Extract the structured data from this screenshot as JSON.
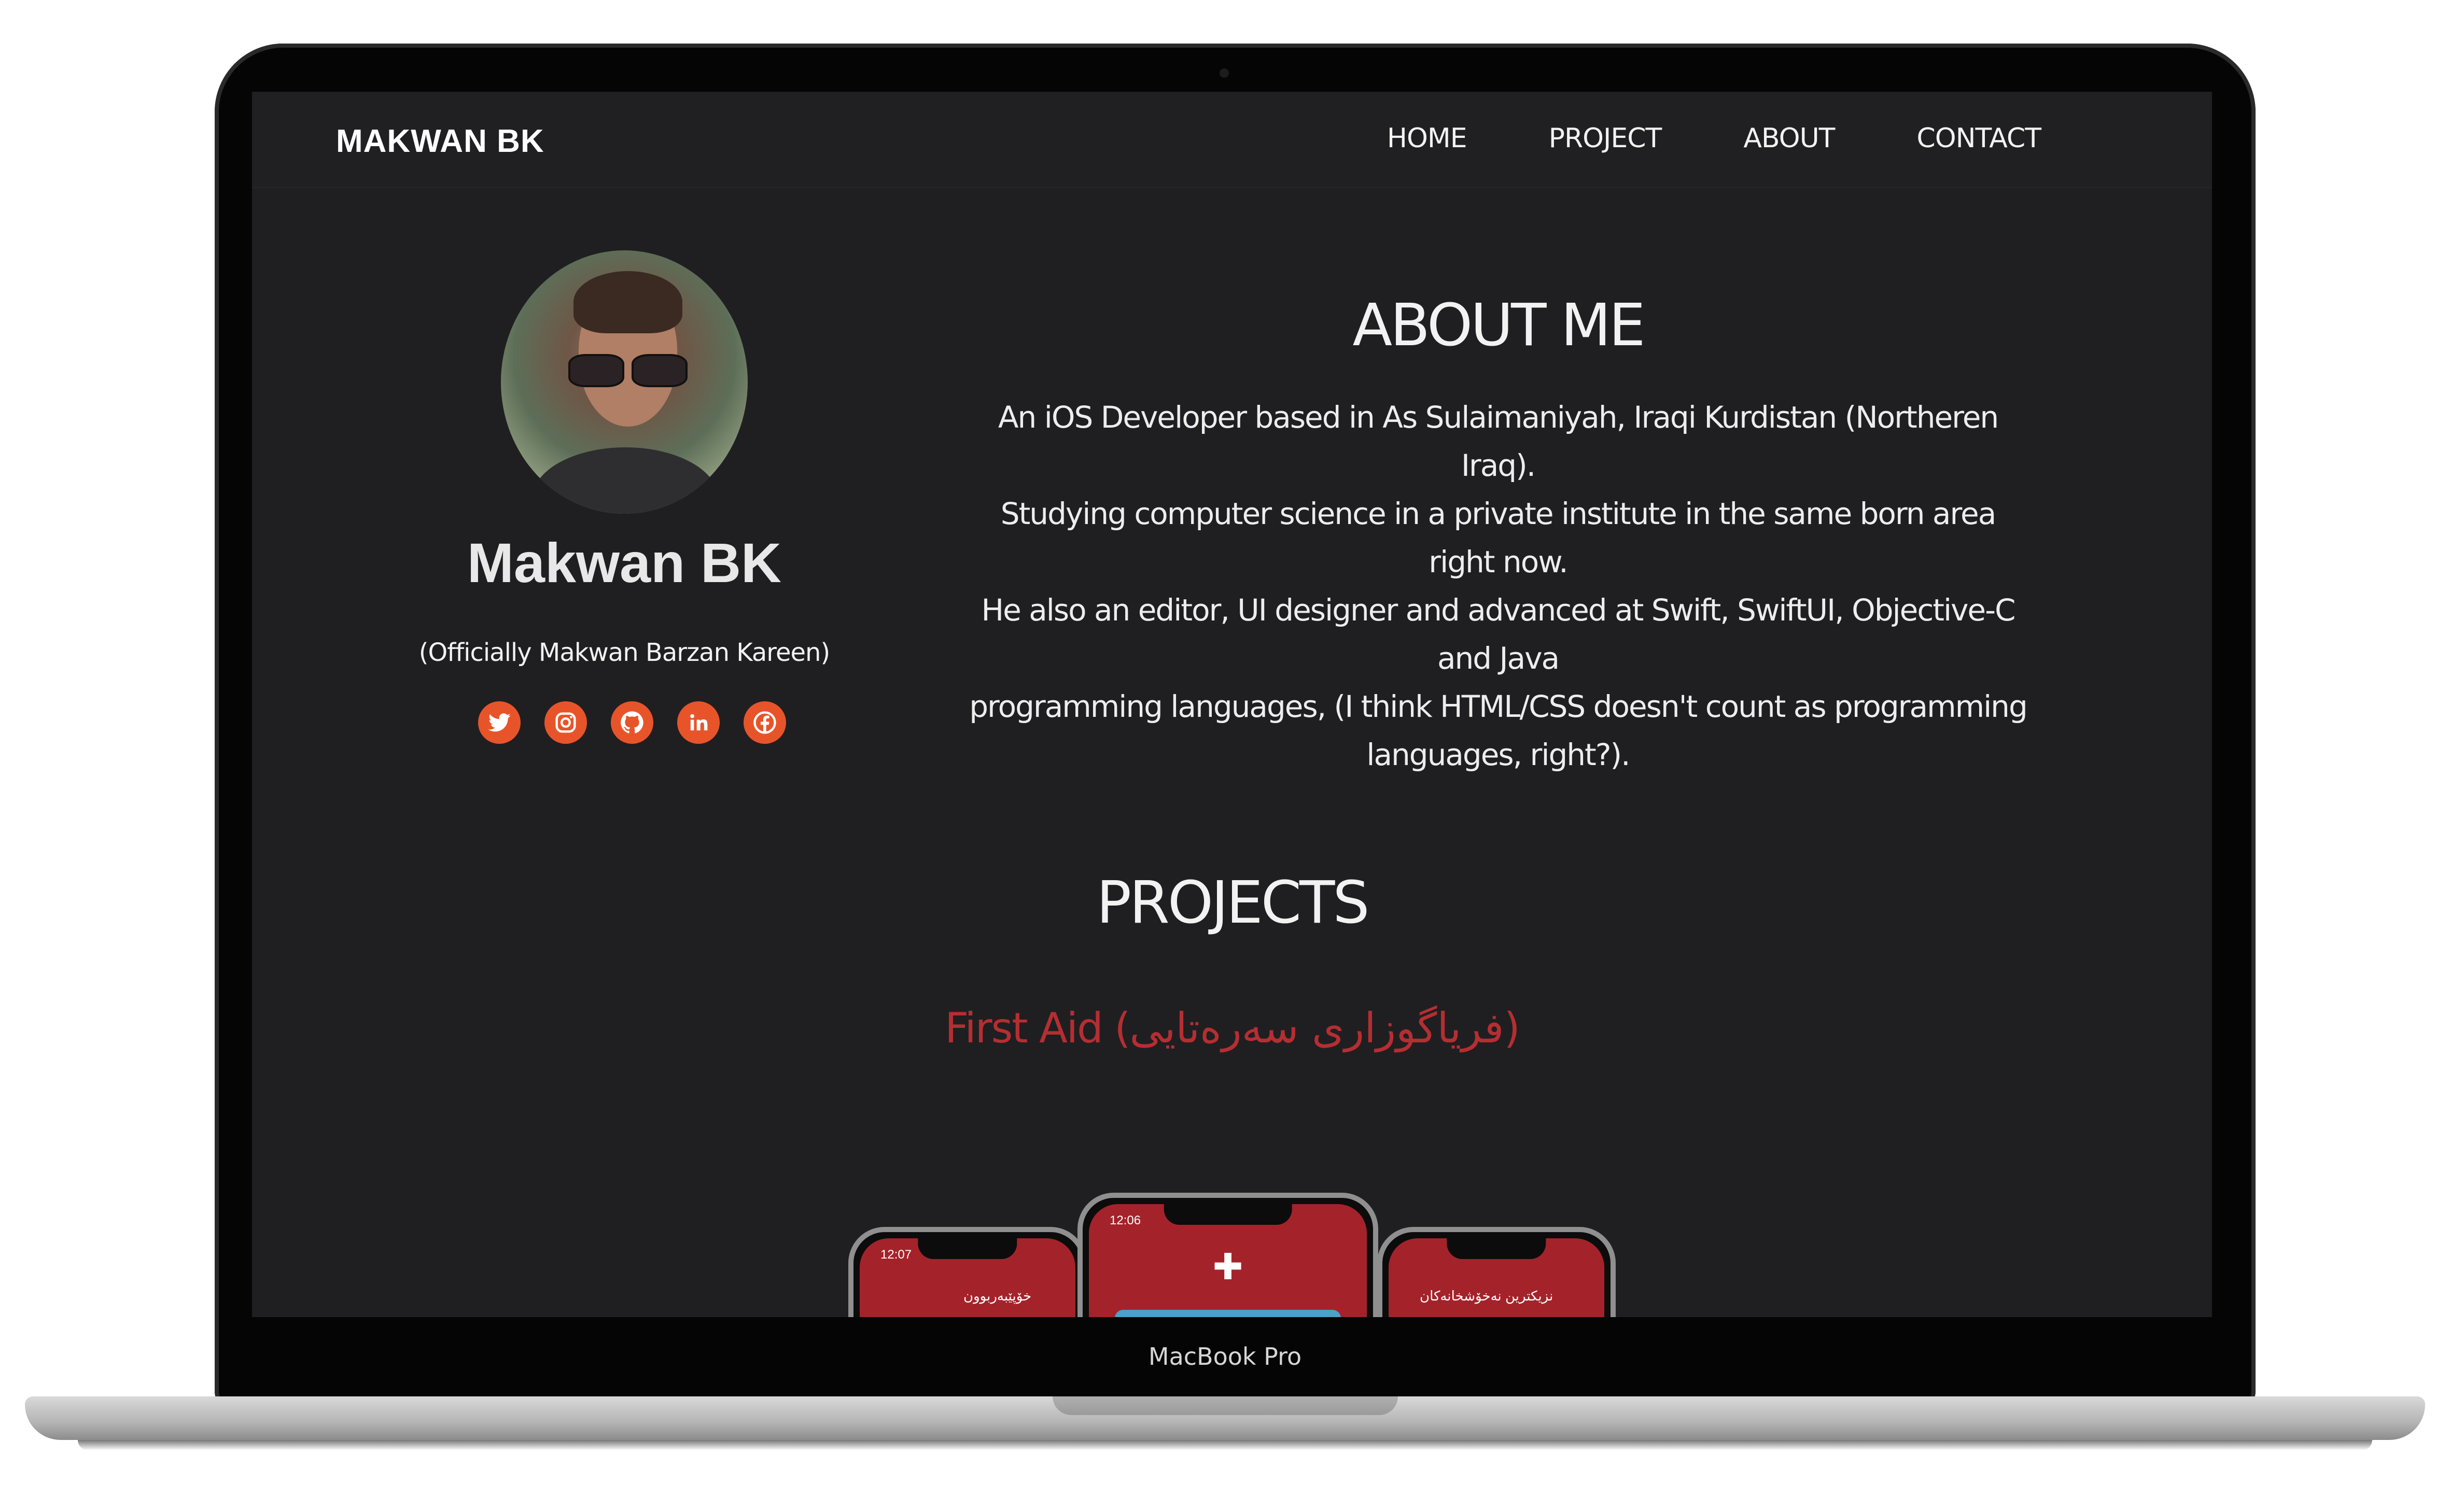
{
  "device": {
    "label": "MacBook Pro"
  },
  "site": {
    "brand": "MAKWAN BK",
    "nav": [
      "HOME",
      "PROJECT",
      "ABOUT",
      "CONTACT"
    ]
  },
  "profile": {
    "name": "Makwan BK",
    "fullname": "(Officially Makwan Barzan Kareen)",
    "socials": [
      "twitter-icon",
      "instagram-icon",
      "github-icon",
      "linkedin-icon",
      "facebook-icon"
    ],
    "accent": "#e8542a"
  },
  "about": {
    "title": "ABOUT ME",
    "lines": [
      "An iOS Developer based in As Sulaimaniyah, Iraqi Kurdistan (Northeren Iraq).",
      "Studying computer science in a private institute in the same born area right now.",
      "He also an editor, UI designer and advanced at Swift, SwiftUI, Objective-C and Java",
      "programming languages, (I think HTML/CSS doesn't count as programming",
      "languages, right?)."
    ]
  },
  "projects": {
    "title": "PROJECTS",
    "first": {
      "label": "First Aid (فریاگوزاری سەرەتایی)",
      "color": "#b52e32"
    },
    "phones": [
      {
        "time": "12:07",
        "caption": "خۆپێبەربوون"
      },
      {
        "time": "12:06",
        "caption": ""
      },
      {
        "time": "",
        "caption": "نزیکترین نەخۆشخانەکان"
      }
    ]
  }
}
